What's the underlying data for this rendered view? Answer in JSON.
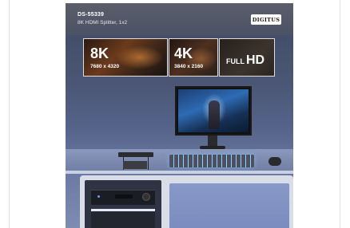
{
  "product": {
    "sku": "DS-55339",
    "name": "8K HDMI Splitter, 1x2",
    "brand_logo": "DIGITUS"
  },
  "banners": [
    {
      "big": "8K",
      "resolution": "7680 x 4320"
    },
    {
      "big": "4K",
      "resolution": "3840 x 2160"
    },
    {
      "prefix": "FULL",
      "big": "HD"
    }
  ],
  "colors": {
    "background": "#ffffff",
    "room": "#55638a",
    "banner_border": "#ffffff"
  }
}
